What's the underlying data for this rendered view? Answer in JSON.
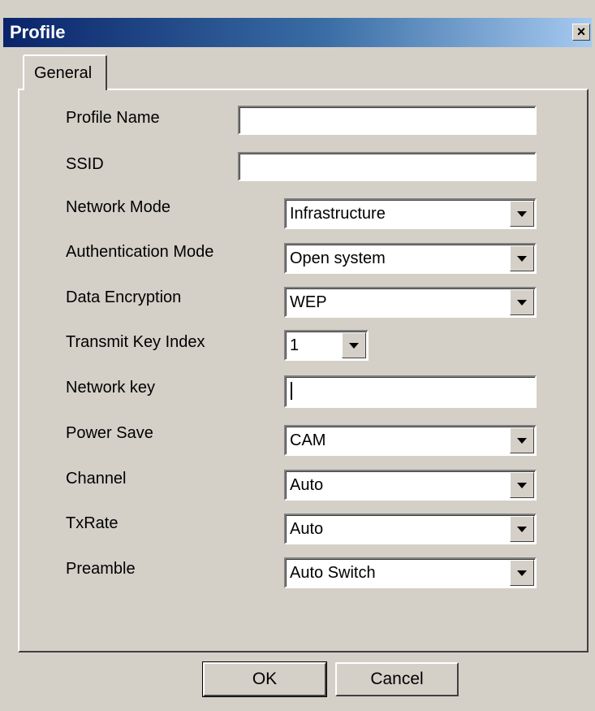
{
  "window": {
    "title": "Profile",
    "close_glyph": "×"
  },
  "tabs": [
    {
      "label": "General",
      "selected": true
    }
  ],
  "form": {
    "profile_name": {
      "label": "Profile Name",
      "value": ""
    },
    "ssid": {
      "label": "SSID",
      "value": ""
    },
    "network_mode": {
      "label": "Network Mode",
      "value": "Infrastructure"
    },
    "authentication_mode": {
      "label": "Authentication Mode",
      "value": "Open system"
    },
    "data_encryption": {
      "label": "Data Encryption",
      "value": "WEP"
    },
    "transmit_key_index": {
      "label": "Transmit Key Index",
      "value": "1"
    },
    "network_key": {
      "label": "Network key",
      "value": ""
    },
    "power_save": {
      "label": "Power Save",
      "value": "CAM"
    },
    "channel": {
      "label": "Channel",
      "value": "Auto"
    },
    "txrate": {
      "label": "TxRate",
      "value": "Auto"
    },
    "preamble": {
      "label": "Preamble",
      "value": "Auto Switch"
    }
  },
  "buttons": {
    "ok": "OK",
    "cancel": "Cancel"
  },
  "colors": {
    "face": "#d4d0c8",
    "title_start": "#0a246a",
    "title_end": "#a6caf0"
  }
}
